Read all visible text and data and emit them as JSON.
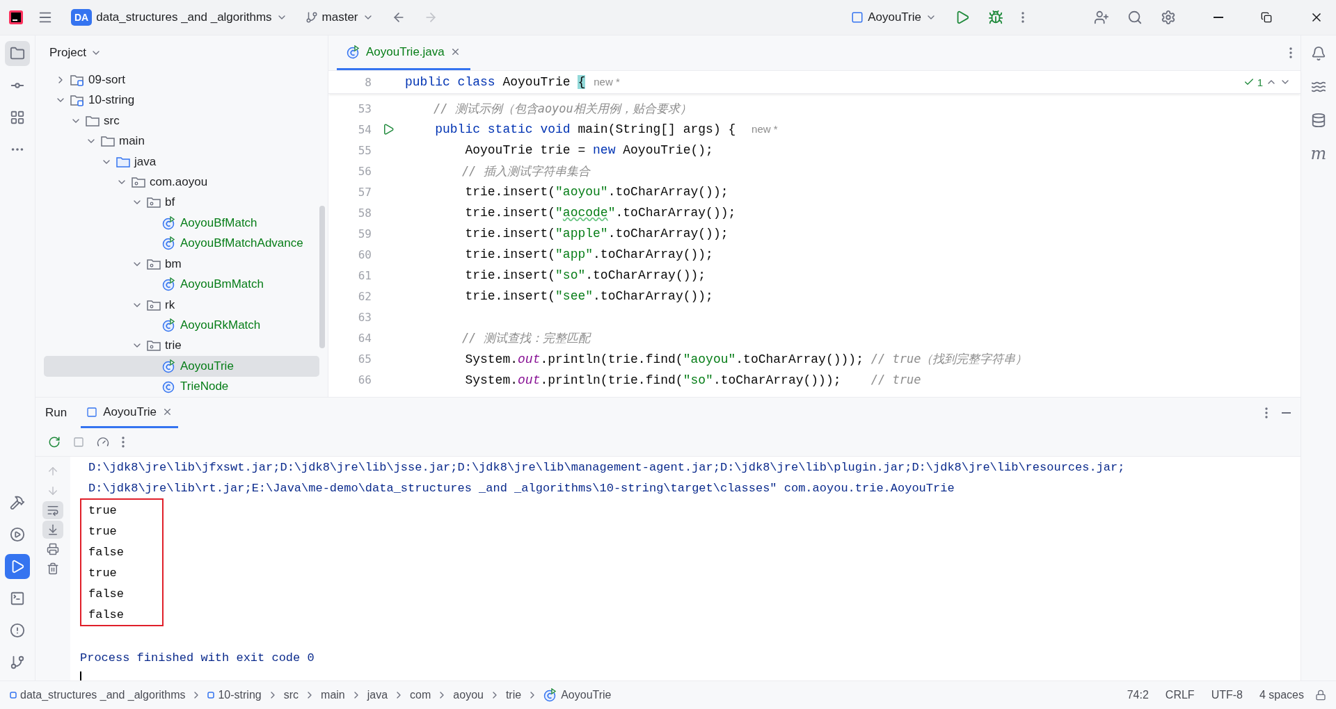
{
  "title_bar": {
    "project_badge": "DA",
    "project_name": "data_structures _and _algorithms",
    "branch": "master",
    "run_config": "AoyouTrie"
  },
  "left_toolbar": {
    "top": [
      {
        "kind": "project",
        "selected": true
      },
      {
        "kind": "commit",
        "selected": false
      },
      {
        "kind": "structure",
        "selected": false
      },
      {
        "kind": "more",
        "selected": false
      }
    ],
    "bottom": [
      {
        "kind": "build",
        "selected": false
      },
      {
        "kind": "services",
        "selected": false
      },
      {
        "kind": "run",
        "selected": true
      },
      {
        "kind": "terminal",
        "selected": false
      },
      {
        "kind": "problems",
        "selected": false
      },
      {
        "kind": "git",
        "selected": false
      }
    ]
  },
  "right_toolbar": [
    {
      "kind": "notifications"
    },
    {
      "kind": "assistant"
    },
    {
      "kind": "database"
    },
    {
      "kind": "char",
      "char": "m"
    }
  ],
  "project_panel": {
    "title": "Project",
    "tree": [
      {
        "name": "09-sort",
        "kind": "module",
        "expanded": false,
        "selected": false
      },
      {
        "name": "10-string",
        "kind": "module",
        "expanded": true,
        "selected": false,
        "children": [
          {
            "name": "src",
            "kind": "folder",
            "expanded": true,
            "selected": false,
            "children": [
              {
                "name": "main",
                "kind": "folder",
                "expanded": true,
                "selected": false,
                "children": [
                  {
                    "name": "java",
                    "kind": "source",
                    "expanded": true,
                    "selected": false,
                    "children": [
                      {
                        "name": "com.aoyou",
                        "kind": "package",
                        "expanded": true,
                        "selected": false,
                        "children": [
                          {
                            "name": "bf",
                            "kind": "package",
                            "expanded": true,
                            "selected": false,
                            "children": [
                              {
                                "name": "AoyouBfMatch",
                                "kind": "runnable_class",
                                "selected": false
                              },
                              {
                                "name": "AoyouBfMatchAdvance",
                                "kind": "runnable_class",
                                "selected": false
                              }
                            ]
                          },
                          {
                            "name": "bm",
                            "kind": "package",
                            "expanded": true,
                            "selected": false,
                            "children": [
                              {
                                "name": "AoyouBmMatch",
                                "kind": "runnable_class",
                                "selected": false
                              }
                            ]
                          },
                          {
                            "name": "rk",
                            "kind": "package",
                            "expanded": true,
                            "selected": false,
                            "children": [
                              {
                                "name": "AoyouRkMatch",
                                "kind": "runnable_class",
                                "selected": false
                              }
                            ]
                          },
                          {
                            "name": "trie",
                            "kind": "package",
                            "expanded": true,
                            "selected": false,
                            "children": [
                              {
                                "name": "AoyouTrie",
                                "kind": "runnable_class",
                                "selected": true
                              },
                              {
                                "name": "TrieNode",
                                "kind": "class",
                                "selected": false
                              }
                            ]
                          }
                        ]
                      }
                    ]
                  }
                ]
              }
            ]
          }
        ]
      }
    ]
  },
  "editor": {
    "tabs": [
      {
        "label": "AoyouTrie.java",
        "selected": true
      }
    ],
    "sticky_line": {
      "number": "8",
      "tokens": [
        {
          "kind": "keyword",
          "text": "public class "
        },
        {
          "kind": "plain",
          "text": "AoyouTrie "
        },
        {
          "kind": "brace",
          "text": "{"
        },
        {
          "kind": "hint",
          "text": "new *"
        }
      ]
    },
    "inspection_count": "1",
    "lines": [
      {
        "number": "53",
        "tokens": [
          {
            "kind": "comment",
            "text": "    // 测试示例（包含aoyou相关用例，贴合要求）"
          }
        ]
      },
      {
        "number": "54",
        "run_gutter": true,
        "tokens": [
          {
            "kind": "keyword",
            "text": "    public static void "
          },
          {
            "kind": "plain",
            "text": "main(String[] args) { "
          },
          {
            "kind": "hint",
            "text": "new *"
          }
        ]
      },
      {
        "number": "55",
        "tokens": [
          {
            "kind": "plain",
            "text": "        AoyouTrie trie = "
          },
          {
            "kind": "keyword",
            "text": "new"
          },
          {
            "kind": "plain",
            "text": " AoyouTrie();"
          }
        ]
      },
      {
        "number": "56",
        "tokens": [
          {
            "kind": "comment",
            "text": "        // 插入测试字符串集合"
          }
        ]
      },
      {
        "number": "57",
        "tokens": [
          {
            "kind": "plain",
            "text": "        trie.insert("
          },
          {
            "kind": "string",
            "text": "\"aoyou\""
          },
          {
            "kind": "plain",
            "text": ".toCharArray());"
          }
        ]
      },
      {
        "number": "58",
        "tokens": [
          {
            "kind": "plain",
            "text": "        trie.insert("
          },
          {
            "kind": "string",
            "text": "\""
          },
          {
            "kind": "string_typo",
            "text": "aocode"
          },
          {
            "kind": "string",
            "text": "\""
          },
          {
            "kind": "plain",
            "text": ".toCharArray());"
          }
        ]
      },
      {
        "number": "59",
        "tokens": [
          {
            "kind": "plain",
            "text": "        trie.insert("
          },
          {
            "kind": "string",
            "text": "\"apple\""
          },
          {
            "kind": "plain",
            "text": ".toCharArray());"
          }
        ]
      },
      {
        "number": "60",
        "tokens": [
          {
            "kind": "plain",
            "text": "        trie.insert("
          },
          {
            "kind": "string",
            "text": "\"app\""
          },
          {
            "kind": "plain",
            "text": ".toCharArray());"
          }
        ]
      },
      {
        "number": "61",
        "tokens": [
          {
            "kind": "plain",
            "text": "        trie.insert("
          },
          {
            "kind": "string",
            "text": "\"so\""
          },
          {
            "kind": "plain",
            "text": ".toCharArray());"
          }
        ]
      },
      {
        "number": "62",
        "tokens": [
          {
            "kind": "plain",
            "text": "        trie.insert("
          },
          {
            "kind": "string",
            "text": "\"see\""
          },
          {
            "kind": "plain",
            "text": ".toCharArray());"
          }
        ]
      },
      {
        "number": "63"
      },
      {
        "number": "64",
        "tokens": [
          {
            "kind": "comment",
            "text": "        // 测试查找：完整匹配"
          }
        ]
      },
      {
        "number": "65",
        "tokens": [
          {
            "kind": "plain",
            "text": "        System."
          },
          {
            "kind": "field",
            "text": "out"
          },
          {
            "kind": "plain",
            "text": ".println(trie.find("
          },
          {
            "kind": "string",
            "text": "\"aoyou\""
          },
          {
            "kind": "plain",
            "text": ".toCharArray())); "
          },
          {
            "kind": "comment",
            "text": "// true（找到完整字符串）"
          }
        ]
      },
      {
        "number": "66",
        "tokens": [
          {
            "kind": "plain",
            "text": "        System."
          },
          {
            "kind": "field",
            "text": "out"
          },
          {
            "kind": "plain",
            "text": ".println(trie.find("
          },
          {
            "kind": "string",
            "text": "\"so\""
          },
          {
            "kind": "plain",
            "text": ".toCharArray()));    "
          },
          {
            "kind": "comment",
            "text": "// true"
          }
        ]
      }
    ]
  },
  "run_panel": {
    "title": "Run",
    "tabs": [
      {
        "label": "AoyouTrie",
        "selected": true
      }
    ],
    "command_lines": [
      "D:\\jdk8\\jre\\lib\\jfxswt.jar;D:\\jdk8\\jre\\lib\\jsse.jar;D:\\jdk8\\jre\\lib\\management-agent.jar;D:\\jdk8\\jre\\lib\\plugin.jar;D:\\jdk8\\jre\\lib\\resources.jar;",
      "D:\\jdk8\\jre\\lib\\rt.jar;E:\\Java\\me-demo\\data_structures _and _algorithms\\10-string\\target\\classes\" com.aoyou.trie.AoyouTrie"
    ],
    "results": [
      "true",
      "true",
      "false",
      "true",
      "false",
      "false"
    ],
    "exit_message": "Process finished with exit code 0"
  },
  "status_bar": {
    "breadcrumbs": [
      {
        "label": "data_structures _and _algorithms",
        "kind": "module"
      },
      {
        "label": "10-string",
        "kind": "module"
      },
      {
        "label": "src",
        "kind": "plain"
      },
      {
        "label": "main",
        "kind": "plain"
      },
      {
        "label": "java",
        "kind": "plain"
      },
      {
        "label": "com",
        "kind": "plain"
      },
      {
        "label": "aoyou",
        "kind": "plain"
      },
      {
        "label": "trie",
        "kind": "plain"
      },
      {
        "label": "AoyouTrie",
        "kind": "class"
      }
    ],
    "position": "74:2",
    "line_separator": "CRLF",
    "encoding": "UTF-8",
    "indent": "4 spaces"
  }
}
